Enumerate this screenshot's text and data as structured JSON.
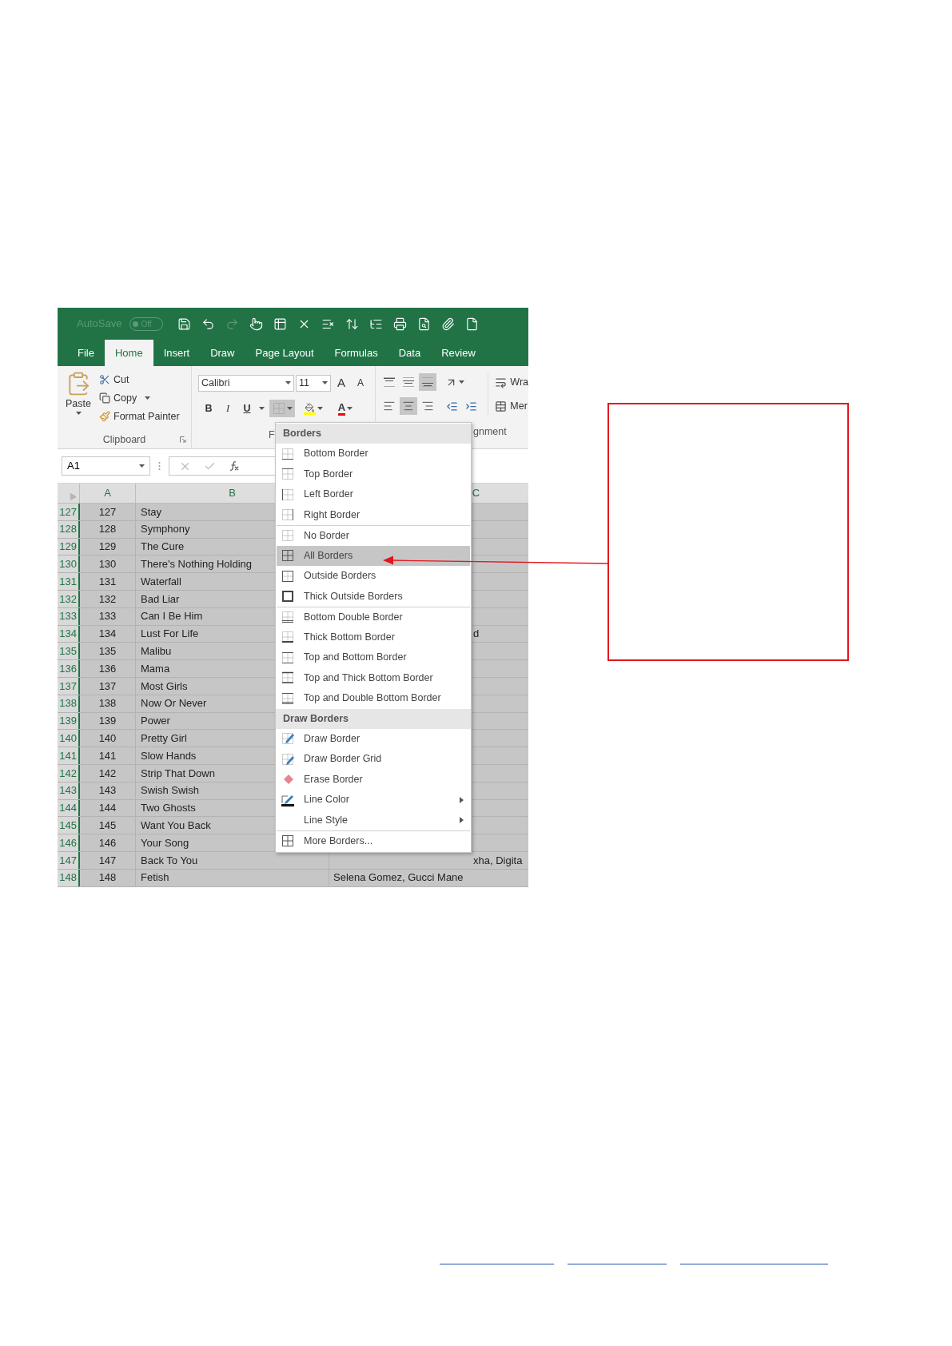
{
  "quick_access": {
    "autosave_label": "AutoSave",
    "autosave_state": "Off",
    "autosave_on": false
  },
  "tabs": [
    {
      "label": "File",
      "selected": false
    },
    {
      "label": "Home",
      "selected": true
    },
    {
      "label": "Insert",
      "selected": false
    },
    {
      "label": "Draw",
      "selected": false
    },
    {
      "label": "Page Layout",
      "selected": false
    },
    {
      "label": "Formulas",
      "selected": false
    },
    {
      "label": "Data",
      "selected": false
    },
    {
      "label": "Review",
      "selected": false
    }
  ],
  "clipboard": {
    "paste": "Paste",
    "cut": "Cut",
    "copy": "Copy",
    "format_painter": "Format Painter",
    "group_label": "Clipboard"
  },
  "font": {
    "name": "Calibri",
    "size": "11",
    "grow": "A",
    "shrink": "A",
    "bold": "B",
    "italic": "I",
    "underline": "U",
    "font_color": "A",
    "borders_pressed": true,
    "group_label": "F"
  },
  "alignment": {
    "top_row": [
      {
        "kind": "top",
        "selected": false
      },
      {
        "kind": "middle",
        "selected": false
      },
      {
        "kind": "bottom",
        "selected": true
      }
    ],
    "bottom_row": [
      {
        "kind": "left",
        "selected": false
      },
      {
        "kind": "center",
        "selected": true
      },
      {
        "kind": "right",
        "selected": false
      }
    ],
    "group_label": "gnment",
    "wrap": "Wra",
    "merge": "Mer"
  },
  "formula_bar": {
    "name_box": "A1"
  },
  "columns": [
    "A",
    "B",
    "C"
  ],
  "rows": [
    {
      "header": "127",
      "a": "127",
      "b": "Stay"
    },
    {
      "header": "128",
      "a": "128",
      "b": "Symphony"
    },
    {
      "header": "129",
      "a": "129",
      "b": "The Cure"
    },
    {
      "header": "130",
      "a": "130",
      "b": "There's Nothing Holding"
    },
    {
      "header": "131",
      "a": "131",
      "b": "Waterfall"
    },
    {
      "header": "132",
      "a": "132",
      "b": "Bad Liar"
    },
    {
      "header": "133",
      "a": "133",
      "b": "Can I Be Him"
    },
    {
      "header": "134",
      "a": "134",
      "b": "Lust For Life",
      "c": "d"
    },
    {
      "header": "135",
      "a": "135",
      "b": "Malibu"
    },
    {
      "header": "136",
      "a": "136",
      "b": "Mama"
    },
    {
      "header": "137",
      "a": "137",
      "b": "Most Girls"
    },
    {
      "header": "138",
      "a": "138",
      "b": "Now Or Never"
    },
    {
      "header": "139",
      "a": "139",
      "b": "Power"
    },
    {
      "header": "140",
      "a": "140",
      "b": "Pretty Girl"
    },
    {
      "header": "141",
      "a": "141",
      "b": "Slow Hands"
    },
    {
      "header": "142",
      "a": "142",
      "b": "Strip That Down"
    },
    {
      "header": "143",
      "a": "143",
      "b": "Swish Swish"
    },
    {
      "header": "144",
      "a": "144",
      "b": "Two Ghosts"
    },
    {
      "header": "145",
      "a": "145",
      "b": "Want You Back"
    },
    {
      "header": "146",
      "a": "146",
      "b": "Your Song"
    },
    {
      "header": "147",
      "a": "147",
      "b": "Back To You",
      "c": "xha, Digita"
    },
    {
      "header": "148",
      "a": "148",
      "b": "Fetish",
      "c": "Selena Gomez, Gucci Mane"
    }
  ],
  "menu": {
    "groups": [
      {
        "title": "Borders",
        "items": [
          {
            "label": "Bottom Border",
            "kind": "bottom",
            "selected": false,
            "divider_above": false,
            "submenu": false
          },
          {
            "label": "Top Border",
            "kind": "top",
            "selected": false,
            "divider_above": false,
            "submenu": false
          },
          {
            "label": "Left Border",
            "kind": "left",
            "selected": false,
            "divider_above": false,
            "submenu": false
          },
          {
            "label": "Right Border",
            "kind": "right",
            "selected": false,
            "divider_above": false,
            "submenu": false
          },
          {
            "label": "No Border",
            "kind": "none",
            "selected": false,
            "divider_above": true,
            "submenu": false
          },
          {
            "label": "All Borders",
            "kind": "all",
            "selected": true,
            "divider_above": false,
            "submenu": false
          },
          {
            "label": "Outside Borders",
            "kind": "outside",
            "selected": false,
            "divider_above": false,
            "submenu": false
          },
          {
            "label": "Thick Outside Borders",
            "kind": "thick-outside",
            "selected": false,
            "divider_above": false,
            "submenu": false
          },
          {
            "label": "Bottom Double Border",
            "kind": "bottom-double",
            "selected": false,
            "divider_above": true,
            "submenu": false
          },
          {
            "label": "Thick Bottom Border",
            "kind": "thick-bottom",
            "selected": false,
            "divider_above": false,
            "submenu": false
          },
          {
            "label": "Top and Bottom Border",
            "kind": "top-bottom",
            "selected": false,
            "divider_above": false,
            "submenu": false
          },
          {
            "label": "Top and Thick Bottom Border",
            "kind": "top-thick-bottom",
            "selected": false,
            "divider_above": false,
            "submenu": false
          },
          {
            "label": "Top and Double Bottom Border",
            "kind": "top-double-bottom",
            "selected": false,
            "divider_above": false,
            "submenu": false
          }
        ]
      },
      {
        "title": "Draw Borders",
        "items": [
          {
            "label": "Draw Border",
            "kind": "draw",
            "selected": false,
            "divider_above": false,
            "submenu": false
          },
          {
            "label": "Draw Border Grid",
            "kind": "draw-grid",
            "selected": false,
            "divider_above": false,
            "submenu": false
          },
          {
            "label": "Erase Border",
            "kind": "erase",
            "selected": false,
            "divider_above": false,
            "submenu": false
          },
          {
            "label": "Line Color",
            "kind": "line-color",
            "selected": false,
            "divider_above": false,
            "submenu": true
          },
          {
            "label": "Line Style",
            "kind": "line-style",
            "selected": false,
            "divider_above": false,
            "submenu": true
          },
          {
            "label": "More Borders...",
            "kind": "more",
            "selected": false,
            "divider_above": true,
            "submenu": false
          }
        ]
      }
    ]
  }
}
